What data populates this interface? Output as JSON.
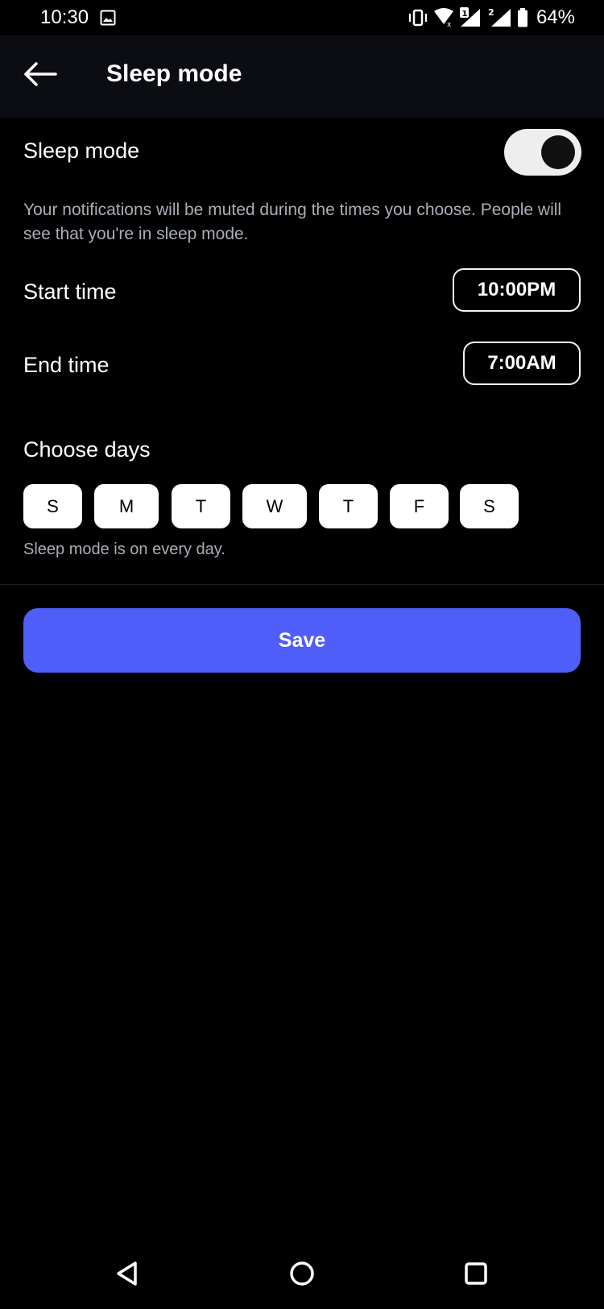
{
  "status_bar": {
    "time": "10:30",
    "battery": "64%",
    "sim1_badge": "1",
    "sim2_badge": "2",
    "icons": [
      "gallery-icon",
      "vibrate-icon",
      "wifi-icon",
      "signal-icon",
      "battery-icon"
    ]
  },
  "header": {
    "title": "Sleep mode",
    "back_icon": "arrow-left-icon"
  },
  "sleep_mode": {
    "label": "Sleep mode",
    "enabled": true,
    "description": "Your notifications will be muted during the times you choose. People will see that you're in sleep mode."
  },
  "start_time": {
    "label": "Start time",
    "value": "10:00PM"
  },
  "end_time": {
    "label": "End time",
    "value": "7:00AM"
  },
  "days": {
    "label": "Choose days",
    "items": [
      "S",
      "M",
      "T",
      "W",
      "T",
      "F",
      "S"
    ],
    "note": "Sleep mode is on every day."
  },
  "save": {
    "label": "Save"
  },
  "colors": {
    "background": "#000000",
    "header_bg": "#0b0d12",
    "accent": "#4f5ef8",
    "secondary_text": "#a9aeb7"
  },
  "nav_bar": {
    "icons": [
      "back-triangle-icon",
      "home-circle-icon",
      "recents-square-icon"
    ]
  }
}
